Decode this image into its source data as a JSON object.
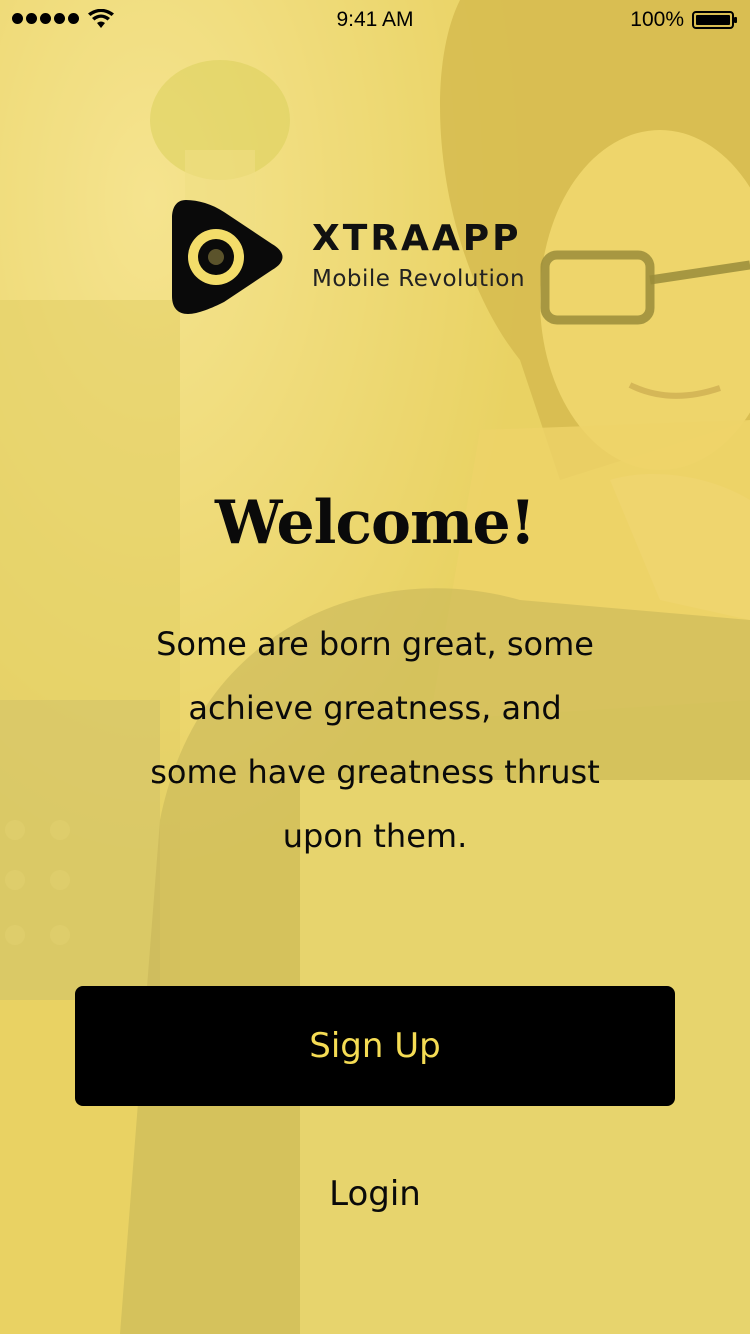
{
  "status_bar": {
    "time": "9:41 AM",
    "battery_percent": "100%",
    "signal_bars": 5,
    "icons": [
      "signal-dots-icon",
      "wifi-icon",
      "battery-icon"
    ]
  },
  "brand": {
    "name": "XTRAAPP",
    "tagline": "Mobile Revolution",
    "logo_icon": "play-eye-logo-icon"
  },
  "welcome": {
    "title": "Welcome!",
    "quote_lines": [
      "Some are born great, some",
      "achieve greatness, and",
      "some have greatness thrust",
      "upon them."
    ]
  },
  "actions": {
    "signup_label": "Sign Up",
    "login_label": "Login"
  },
  "colors": {
    "accent_yellow": "#f5dc54",
    "overlay_yellow": "#f6de5a",
    "button_black": "#000000",
    "text_dark": "#0a0a0a"
  }
}
